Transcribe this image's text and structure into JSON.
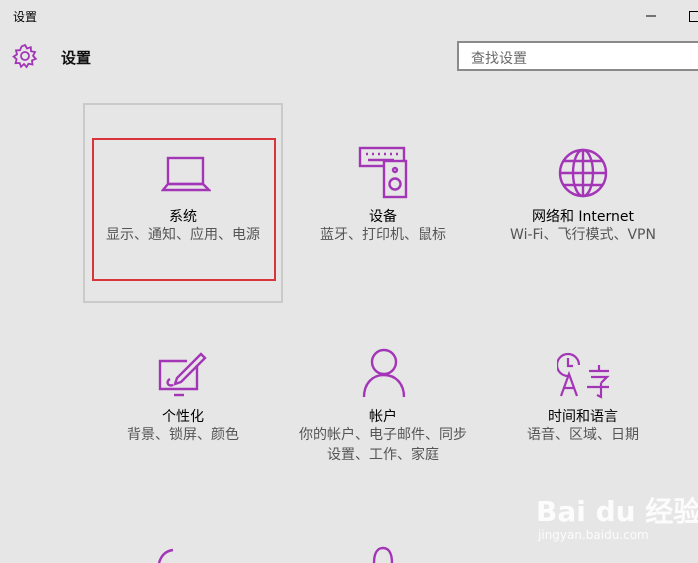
{
  "window": {
    "title": "设置"
  },
  "header": {
    "title": "设置",
    "icon": "gear-icon"
  },
  "search": {
    "placeholder": "查找设置"
  },
  "accent_color": "#a335b7",
  "tiles": [
    {
      "title": "系统",
      "subtitle": "显示、通知、应用、电源",
      "icon": "laptop-icon"
    },
    {
      "title": "设备",
      "subtitle": "蓝牙、打印机、鼠标",
      "icon": "devices-icon"
    },
    {
      "title": "网络和 Internet",
      "subtitle": "Wi-Fi、飞行模式、VPN",
      "icon": "globe-icon"
    },
    {
      "title": "个性化",
      "subtitle": "背景、锁屏、颜色",
      "icon": "personalization-icon"
    },
    {
      "title": "帐户",
      "subtitle": "你的帐户、电子邮件、同步设置、工作、家庭",
      "icon": "person-icon"
    },
    {
      "title": "时间和语言",
      "subtitle": "语音、区域、日期",
      "icon": "time-language-icon"
    }
  ],
  "watermark": {
    "text": "Bai du 经验",
    "sub": "jingyan.baidu.com"
  }
}
